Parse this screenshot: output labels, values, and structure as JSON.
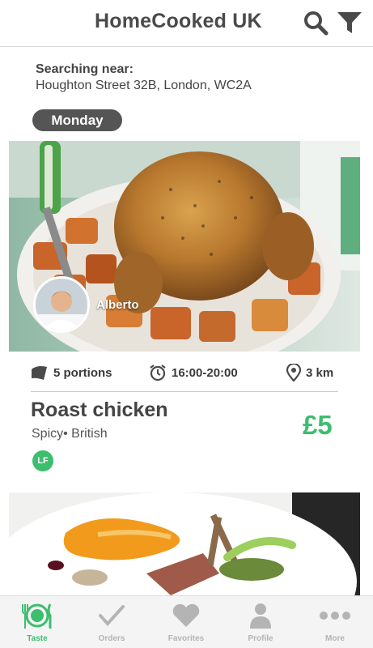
{
  "header": {
    "title": "HomeCooked UK",
    "search_icon": "search-icon",
    "filter_icon": "filter-icon"
  },
  "location": {
    "label": "Searching near:",
    "address": "Houghton Street 32B, London, WC2A"
  },
  "day": "Monday",
  "listing": {
    "chef_name": "Alberto",
    "portions": "5 portions",
    "time": "16:00-20:00",
    "distance": "3 km",
    "name": "Roast chicken",
    "tags": "Spicy• British",
    "price": "£5",
    "badge": "LF"
  },
  "nav": {
    "items": [
      {
        "label": "Taste",
        "icon": "dinner-plate-icon",
        "active": true
      },
      {
        "label": "Orders",
        "icon": "checkmark-icon",
        "active": false
      },
      {
        "label": "Favorites",
        "icon": "heart-icon",
        "active": false
      },
      {
        "label": "Profile",
        "icon": "person-icon",
        "active": false
      },
      {
        "label": "More",
        "icon": "more-dots-icon",
        "active": false
      }
    ]
  },
  "colors": {
    "accent": "#3dbd6e",
    "text": "#444444",
    "pill": "#555555",
    "nav_inactive": "#b4b4b4"
  }
}
